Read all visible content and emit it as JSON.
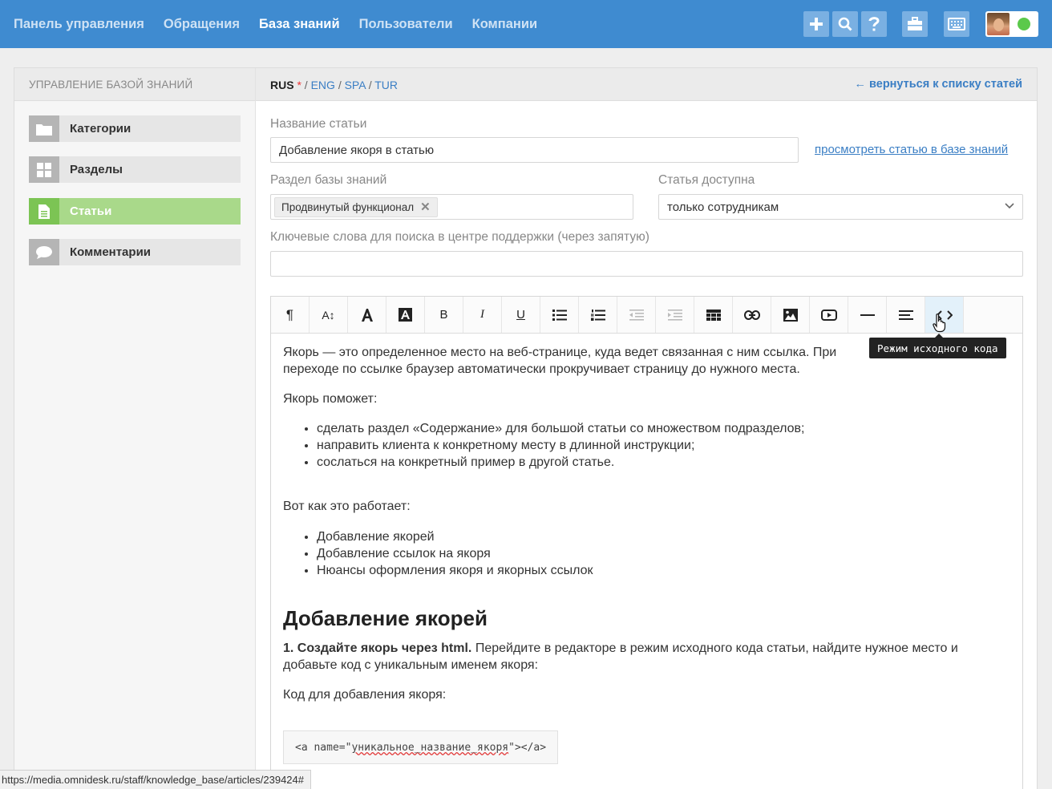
{
  "nav": {
    "items": [
      "Панель управления",
      "Обращения",
      "База знаний",
      "Пользователи",
      "Компании"
    ],
    "active_index": 2
  },
  "topbar": {
    "icons": [
      "plus-icon",
      "search-icon",
      "help-icon",
      "briefcase-icon",
      "keyboard-icon"
    ],
    "user_status": "online"
  },
  "sidebar": {
    "header": "УПРАВЛЕНИЕ БАЗОЙ ЗНАНИЙ",
    "items": [
      {
        "label": "Категории",
        "icon": "folder-icon"
      },
      {
        "label": "Разделы",
        "icon": "grid-icon"
      },
      {
        "label": "Статьи",
        "icon": "document-icon"
      },
      {
        "label": "Комментарии",
        "icon": "comment-icon"
      }
    ],
    "active_index": 2
  },
  "langs": {
    "current": "RUS",
    "required_mark": "*",
    "separator": "/",
    "others": [
      "ENG",
      "SPA",
      "TUR"
    ]
  },
  "back_link": "← вернуться к списку статей",
  "form": {
    "title_label": "Название статьи",
    "title_value": "Добавление якоря в статью",
    "view_link": "просмотреть статью в базе знаний",
    "section_label": "Раздел базы знаний",
    "section_tag": "Продвинутый функционал",
    "access_label": "Статья доступна",
    "access_value": "только сотрудникам",
    "keywords_label": "Ключевые слова для поиска в центре поддержки (через запятую)",
    "keywords_value": ""
  },
  "toolbar": {
    "buttons": [
      "paragraph-icon",
      "font-size-icon",
      "font-color-icon",
      "background-color-icon",
      "bold-icon",
      "italic-icon",
      "underline-icon",
      "unordered-list-icon",
      "ordered-list-icon",
      "outdent-icon",
      "indent-icon",
      "table-icon",
      "link-icon",
      "image-icon",
      "video-icon",
      "horizontal-rule-icon",
      "align-icon",
      "code-view-icon"
    ],
    "letters": {
      "bold": "B",
      "italic": "I",
      "underline": "U",
      "font_size": "A↕",
      "paragraph": "¶"
    },
    "tooltip": "Режим исходного кода"
  },
  "article": {
    "p1": "Якорь — это определенное место на веб-странице, куда ведет связанная с ним ссылка. При переходе по ссылке браузер автоматически прокручивает страницу до нужного места.",
    "p2": "Якорь поможет:",
    "list1": [
      "сделать раздел «Содержание» для большой статьи со множеством подразделов;",
      "направить клиента к конкретному месту в длинной инструкции;",
      "сослаться на конкретный пример в другой статье."
    ],
    "p3": "Вот как это работает:",
    "list2": [
      "Добавление якорей",
      "Добавление ссылок на якоря",
      "Нюансы оформления якоря и якорных ссылок"
    ],
    "h2": "Добавление якорей",
    "step1_bold": "1. Создайте якорь через html.",
    "step1_text": " Перейдите в редакторе в режим исходного кода статьи, найдите нужное место и добавьте код с уникальным именем якоря:",
    "p4": "Код для добавления якоря:",
    "code_pre": "<a name=\"",
    "code_name": "уникальное_название_якоря",
    "code_post": "\"></a>"
  },
  "status_url": "https://media.omnidesk.ru/staff/knowledge_base/articles/239424#"
}
